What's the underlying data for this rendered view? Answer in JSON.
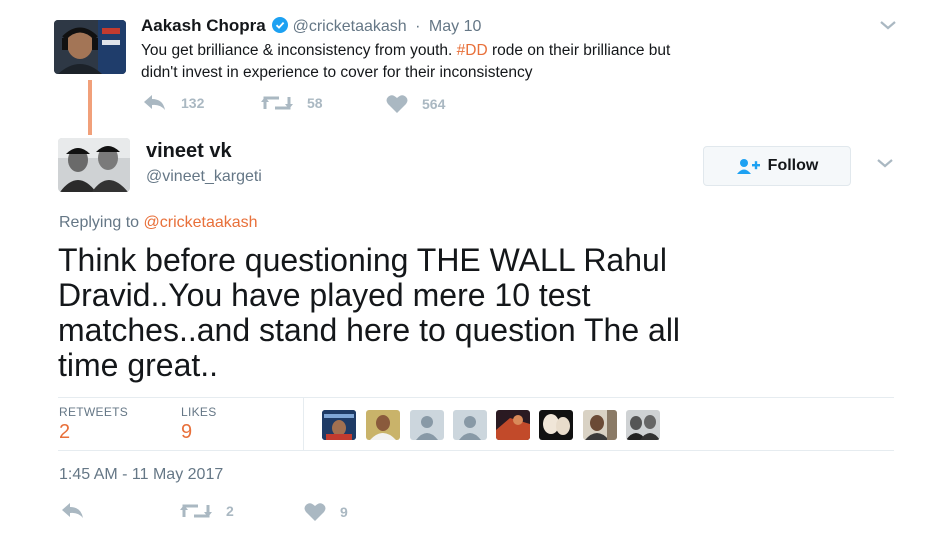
{
  "parent_tweet": {
    "name": "Aakash Chopra",
    "handle": "@cricketaakash",
    "separator": "·",
    "date": "May 10",
    "text_part1": "You get brilliance & inconsistency from youth. ",
    "hashtag": "#DD",
    "text_part2": " rode on their brilliance but",
    "text_line2": "didn't invest in experience to cover for their inconsistency",
    "reply_count": "132",
    "retweet_count": "58",
    "like_count": "564"
  },
  "main_tweet": {
    "name": "vineet vk",
    "handle": "@vineet_kargeti",
    "follow_label": "Follow",
    "replying_prefix": "Replying to ",
    "replying_to": "@cricketaakash",
    "text_line1": "Think before questioning THE WALL Rahul",
    "text_line2": "Dravid..You have played mere 10 test",
    "text_line3": "matches..and stand here to question The all",
    "text_line4": "time great..",
    "retweets_label": "RETWEETS",
    "retweets_value": "2",
    "likes_label": "LIKES",
    "likes_value": "9",
    "timestamp": "1:45 AM - 11 May 2017",
    "footer_retweet_count": "2",
    "footer_like_count": "9"
  },
  "colors": {
    "accent": "#e8703a",
    "muted": "#657786",
    "icon": "#aab8c2",
    "thread_line": "#f1a07a",
    "verified": "#1da1f2"
  }
}
